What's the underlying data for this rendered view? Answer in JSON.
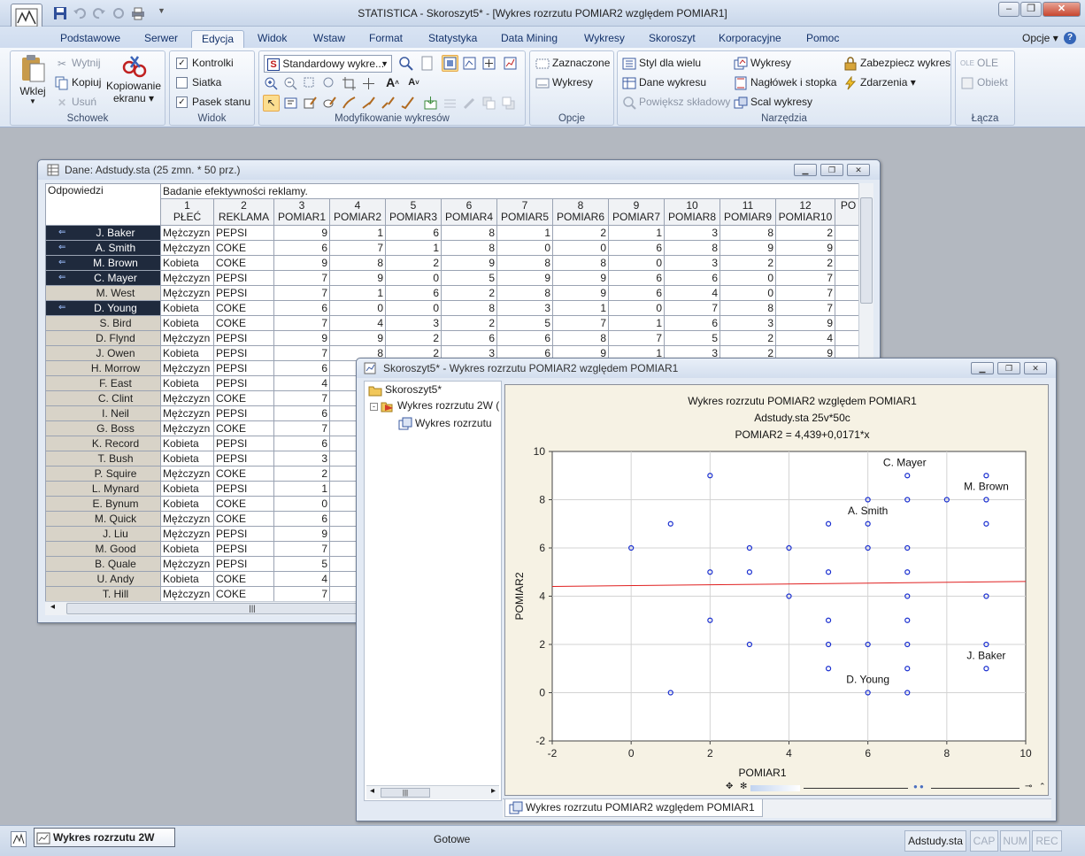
{
  "window": {
    "title": "STATISTICA - Skoroszyt5* - [Wykres rozrzutu  POMIAR2 względem POMIAR1]"
  },
  "tabs": [
    "Podstawowe",
    "Serwer",
    "Edycja",
    "Widok",
    "Wstaw",
    "Format",
    "Statystyka",
    "Data Mining",
    "Wykresy",
    "Skoroszyt",
    "Korporacyjne",
    "Pomoc"
  ],
  "options_label": "Opcje",
  "ribbon": {
    "clipboard": {
      "paste": "Wklej",
      "cut": "Wytnij",
      "copy": "Kopiuj",
      "delete": "Usuń",
      "screen_copy_1": "Kopiowanie",
      "screen_copy_2": "ekranu",
      "label": "Schowek"
    },
    "view": {
      "controls": "Kontrolki",
      "grid": "Siatka",
      "statusbar": "Pasek stanu",
      "label": "Widok"
    },
    "modify": {
      "dropdown": "Standardowy wykre...",
      "label": "Modyfikowanie wykresów"
    },
    "options": {
      "selected": "Zaznaczone",
      "charts": "Wykresy",
      "label": "Opcje"
    },
    "tools": {
      "style_many": "Styl dla wielu",
      "chart_data": "Dane wykresu",
      "enlarge": "Powiększ składowy",
      "graphs": "Wykresy",
      "header_footer": "Nagłówek i stopka",
      "merge": "Scal wykresy",
      "protect": "Zabezpiecz wykres",
      "events": "Zdarzenia",
      "label": "Narzędzia"
    },
    "links": {
      "ole": "OLE",
      "object": "Obiekt",
      "label": "Łącza"
    }
  },
  "data_window": {
    "title": "Dane: Adstudy.sta (25 zmn. * 50 prz.)",
    "corner_label": "Odpowiedzi",
    "description": "Badanie efektywności reklamy.",
    "columns": [
      {
        "num": "1",
        "name": "PŁEĆ"
      },
      {
        "num": "2",
        "name": "REKLAMA"
      },
      {
        "num": "3",
        "name": "POMIAR1"
      },
      {
        "num": "4",
        "name": "POMIAR2"
      },
      {
        "num": "5",
        "name": "POMIAR3"
      },
      {
        "num": "6",
        "name": "POMIAR4"
      },
      {
        "num": "7",
        "name": "POMIAR5"
      },
      {
        "num": "8",
        "name": "POMIAR6"
      },
      {
        "num": "9",
        "name": "POMIAR7"
      },
      {
        "num": "10",
        "name": "POMIAR8"
      },
      {
        "num": "11",
        "name": "POMIAR9"
      },
      {
        "num": "12",
        "name": "POMIAR10"
      },
      {
        "num": "",
        "name": "PO"
      }
    ],
    "rows": [
      {
        "name": "J. Baker",
        "sel": true,
        "c": [
          "Mężczyzn",
          "PEPSI",
          "9",
          "1",
          "6",
          "8",
          "1",
          "2",
          "1",
          "3",
          "8",
          "2"
        ]
      },
      {
        "name": "A. Smith",
        "sel": true,
        "c": [
          "Mężczyzn",
          "COKE",
          "6",
          "7",
          "1",
          "8",
          "0",
          "0",
          "6",
          "8",
          "9",
          "9"
        ]
      },
      {
        "name": "M. Brown",
        "sel": true,
        "c": [
          "Kobieta",
          "COKE",
          "9",
          "8",
          "2",
          "9",
          "8",
          "8",
          "0",
          "3",
          "2",
          "2"
        ]
      },
      {
        "name": "C. Mayer",
        "sel": true,
        "c": [
          "Mężczyzn",
          "PEPSI",
          "7",
          "9",
          "0",
          "5",
          "9",
          "9",
          "6",
          "6",
          "0",
          "7"
        ]
      },
      {
        "name": "M. West",
        "sel": false,
        "c": [
          "Mężczyzn",
          "PEPSI",
          "7",
          "1",
          "6",
          "2",
          "8",
          "9",
          "6",
          "4",
          "0",
          "7"
        ]
      },
      {
        "name": "D. Young",
        "sel": true,
        "c": [
          "Kobieta",
          "COKE",
          "6",
          "0",
          "0",
          "8",
          "3",
          "1",
          "0",
          "7",
          "8",
          "7"
        ]
      },
      {
        "name": "S. Bird",
        "sel": false,
        "c": [
          "Kobieta",
          "COKE",
          "7",
          "4",
          "3",
          "2",
          "5",
          "7",
          "1",
          "6",
          "3",
          "9"
        ]
      },
      {
        "name": "D. Flynd",
        "sel": false,
        "c": [
          "Mężczyzn",
          "PEPSI",
          "9",
          "9",
          "2",
          "6",
          "6",
          "8",
          "7",
          "5",
          "2",
          "4"
        ]
      },
      {
        "name": "J. Owen",
        "sel": false,
        "c": [
          "Kobieta",
          "PEPSI",
          "7",
          "8",
          "2",
          "3",
          "6",
          "9",
          "1",
          "3",
          "2",
          "9"
        ]
      },
      {
        "name": "H. Morrow",
        "sel": false,
        "c": [
          "Mężczyzn",
          "PEPSI",
          "6",
          "",
          "",
          "",
          "",
          "",
          "",
          "",
          "",
          ""
        ]
      },
      {
        "name": "F. East",
        "sel": false,
        "c": [
          "Kobieta",
          "PEPSI",
          "4",
          "",
          "",
          "",
          "",
          "",
          "",
          "",
          "",
          ""
        ]
      },
      {
        "name": "C. Clint",
        "sel": false,
        "c": [
          "Mężczyzn",
          "COKE",
          "7",
          "",
          "",
          "",
          "",
          "",
          "",
          "",
          "",
          ""
        ]
      },
      {
        "name": "I. Neil",
        "sel": false,
        "c": [
          "Mężczyzn",
          "PEPSI",
          "6",
          "",
          "",
          "",
          "",
          "",
          "",
          "",
          "",
          ""
        ]
      },
      {
        "name": "G. Boss",
        "sel": false,
        "c": [
          "Mężczyzn",
          "COKE",
          "7",
          "",
          "",
          "",
          "",
          "",
          "",
          "",
          "",
          ""
        ]
      },
      {
        "name": "K. Record",
        "sel": false,
        "c": [
          "Kobieta",
          "PEPSI",
          "6",
          "",
          "",
          "",
          "",
          "",
          "",
          "",
          "",
          ""
        ]
      },
      {
        "name": "T. Bush",
        "sel": false,
        "c": [
          "Kobieta",
          "PEPSI",
          "3",
          "",
          "",
          "",
          "",
          "",
          "",
          "",
          "",
          ""
        ]
      },
      {
        "name": "P. Squire",
        "sel": false,
        "c": [
          "Mężczyzn",
          "COKE",
          "2",
          "",
          "",
          "",
          "",
          "",
          "",
          "",
          "",
          ""
        ]
      },
      {
        "name": "L. Mynard",
        "sel": false,
        "c": [
          "Kobieta",
          "PEPSI",
          "1",
          "",
          "",
          "",
          "",
          "",
          "",
          "",
          "",
          ""
        ]
      },
      {
        "name": "E. Bynum",
        "sel": false,
        "c": [
          "Kobieta",
          "COKE",
          "0",
          "",
          "",
          "",
          "",
          "",
          "",
          "",
          "",
          ""
        ]
      },
      {
        "name": "M. Quick",
        "sel": false,
        "c": [
          "Mężczyzn",
          "COKE",
          "6",
          "",
          "",
          "",
          "",
          "",
          "",
          "",
          "",
          ""
        ]
      },
      {
        "name": "J. Liu",
        "sel": false,
        "c": [
          "Mężczyzn",
          "PEPSI",
          "9",
          "",
          "",
          "",
          "",
          "",
          "",
          "",
          "",
          ""
        ]
      },
      {
        "name": "M. Good",
        "sel": false,
        "c": [
          "Kobieta",
          "PEPSI",
          "7",
          "",
          "",
          "",
          "",
          "",
          "",
          "",
          "",
          ""
        ]
      },
      {
        "name": "B. Quale",
        "sel": false,
        "c": [
          "Mężczyzn",
          "PEPSI",
          "5",
          "",
          "",
          "",
          "",
          "",
          "",
          "",
          "",
          ""
        ]
      },
      {
        "name": "U. Andy",
        "sel": false,
        "c": [
          "Kobieta",
          "COKE",
          "4",
          "",
          "",
          "",
          "",
          "",
          "",
          "",
          "",
          ""
        ]
      },
      {
        "name": "T. Hill",
        "sel": false,
        "c": [
          "Mężczyzn",
          "COKE",
          "7",
          "",
          "",
          "",
          "",
          "",
          "",
          "",
          "",
          ""
        ]
      }
    ]
  },
  "workbook": {
    "title": "Skoroszyt5* - Wykres rozrzutu  POMIAR2 względem POMIAR1",
    "tree": {
      "root": "Skoroszyt5*",
      "folder": "Wykres rozrzutu 2W (",
      "item": "Wykres rozrzutu"
    },
    "bottom_tab": "Wykres rozrzutu  POMIAR2 względem POMIAR1"
  },
  "chart_data": {
    "type": "scatter",
    "title": "Wykres rozrzutu   POMIAR2 względem POMIAR1",
    "subtitle": "Adstudy.sta 25v*50c",
    "equation": "POMIAR2 = 4,439+0,0171*x",
    "xlabel": "POMIAR1",
    "ylabel": "POMIAR2",
    "xlim": [
      -2,
      10
    ],
    "ylim": [
      -2,
      10
    ],
    "xticks": [
      "-2",
      "0",
      "2",
      "4",
      "6",
      "8",
      "10"
    ],
    "yticks": [
      "-2",
      "0",
      "2",
      "4",
      "6",
      "8",
      "10"
    ],
    "grid": true,
    "points": [
      [
        0,
        6
      ],
      [
        1,
        7
      ],
      [
        1,
        0
      ],
      [
        2,
        9
      ],
      [
        2,
        5
      ],
      [
        2,
        3
      ],
      [
        3,
        6
      ],
      [
        3,
        5
      ],
      [
        3,
        2
      ],
      [
        4,
        6
      ],
      [
        4,
        4
      ],
      [
        5,
        7
      ],
      [
        5,
        5
      ],
      [
        5,
        3
      ],
      [
        5,
        2
      ],
      [
        5,
        1
      ],
      [
        6,
        8
      ],
      [
        6,
        7
      ],
      [
        6,
        6
      ],
      [
        6,
        2
      ],
      [
        6,
        0
      ],
      [
        7,
        9
      ],
      [
        7,
        8
      ],
      [
        7,
        6
      ],
      [
        7,
        5
      ],
      [
        7,
        4
      ],
      [
        7,
        3
      ],
      [
        7,
        2
      ],
      [
        7,
        1
      ],
      [
        7,
        0
      ],
      [
        8,
        8
      ],
      [
        9,
        9
      ],
      [
        9,
        8
      ],
      [
        9,
        7
      ],
      [
        9,
        4
      ],
      [
        9,
        2
      ],
      [
        9,
        1
      ]
    ],
    "regression": {
      "intercept": 4.439,
      "slope": 0.0171,
      "color": "#e02020"
    },
    "point_color": "#1a2fd0",
    "labels": [
      {
        "text": "C. Mayer",
        "x": 7,
        "y": 9
      },
      {
        "text": "M. Brown",
        "x": 9,
        "y": 8
      },
      {
        "text": "A. Smith",
        "x": 6,
        "y": 7
      },
      {
        "text": "J. Baker",
        "x": 9,
        "y": 1
      },
      {
        "text": "D. Young",
        "x": 6,
        "y": 0
      }
    ]
  },
  "statusbar": {
    "task": "Wykres rozrzutu 2W",
    "status": "Gotowe",
    "file": "Adstudy.sta",
    "cap": "CAP",
    "num": "NUM",
    "rec": "REC"
  }
}
